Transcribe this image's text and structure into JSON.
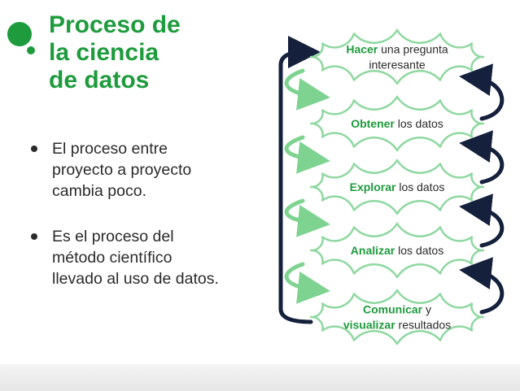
{
  "slide": {
    "title_lines": [
      "Proceso de",
      "la ciencia",
      "de datos"
    ],
    "bullets": [
      [
        "El proceso entre",
        "proyecto a proyecto",
        "cambia poco."
      ],
      [
        "Es el proceso del",
        "método científico",
        "llevado al uso de datos."
      ]
    ]
  },
  "diagram": {
    "steps": [
      {
        "lines": [
          [
            {
              "t": "Hacer",
              "bold": true
            },
            {
              "t": " una pregunta"
            }
          ],
          [
            {
              "t": "interesante"
            }
          ]
        ]
      },
      {
        "lines": [
          [
            {
              "t": "Obtener",
              "bold": true
            },
            {
              "t": " los datos"
            }
          ]
        ]
      },
      {
        "lines": [
          [
            {
              "t": "Explorar",
              "bold": true
            },
            {
              "t": " los datos"
            }
          ]
        ]
      },
      {
        "lines": [
          [
            {
              "t": "Analizar",
              "bold": true
            },
            {
              "t": " los datos"
            }
          ]
        ]
      },
      {
        "lines": [
          [
            {
              "t": "Comunicar",
              "bold": true
            },
            {
              "t": " y"
            }
          ],
          [
            {
              "t": "visualizar",
              "bold": true
            },
            {
              "t": " resultados"
            }
          ]
        ]
      }
    ]
  },
  "colors": {
    "accent_green": "#1e9b3d",
    "cloud_border": "#8fd8a0",
    "arrow_green": "#7ed391",
    "arrow_navy": "#14203c"
  }
}
